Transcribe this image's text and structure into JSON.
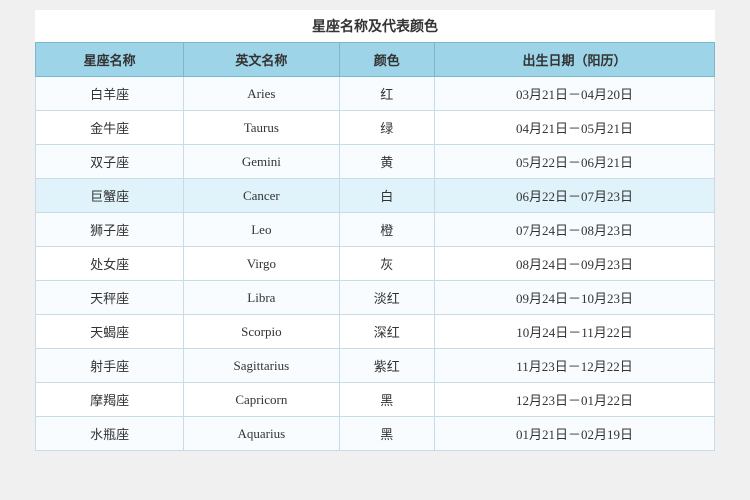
{
  "page": {
    "title": "星座名称及代表颜色",
    "columns": [
      "星座名称",
      "英文名称",
      "颜色",
      "出生日期（阳历）"
    ],
    "rows": [
      {
        "cn": "白羊座",
        "en": "Aries",
        "color": "红",
        "date": "03月21日－04月20日",
        "highlight": false
      },
      {
        "cn": "金牛座",
        "en": "Taurus",
        "color": "绿",
        "date": "04月21日－05月21日",
        "highlight": false
      },
      {
        "cn": "双子座",
        "en": "Gemini",
        "color": "黄",
        "date": "05月22日－06月21日",
        "highlight": false
      },
      {
        "cn": "巨蟹座",
        "en": "Cancer",
        "color": "白",
        "date": "06月22日－07月23日",
        "highlight": true
      },
      {
        "cn": "狮子座",
        "en": "Leo",
        "color": "橙",
        "date": "07月24日－08月23日",
        "highlight": false
      },
      {
        "cn": "处女座",
        "en": "Virgo",
        "color": "灰",
        "date": "08月24日－09月23日",
        "highlight": false
      },
      {
        "cn": "天秤座",
        "en": "Libra",
        "color": "淡红",
        "date": "09月24日－10月23日",
        "highlight": false
      },
      {
        "cn": "天蝎座",
        "en": "Scorpio",
        "color": "深红",
        "date": "10月24日－11月22日",
        "highlight": false
      },
      {
        "cn": "射手座",
        "en": "Sagittarius",
        "color": "紫红",
        "date": "11月23日－12月22日",
        "highlight": false
      },
      {
        "cn": "摩羯座",
        "en": "Capricorn",
        "color": "黑",
        "date": "12月23日－01月22日",
        "highlight": false
      },
      {
        "cn": "水瓶座",
        "en": "Aquarius",
        "color": "黑",
        "date": "01月21日－02月19日",
        "highlight": false
      }
    ]
  }
}
